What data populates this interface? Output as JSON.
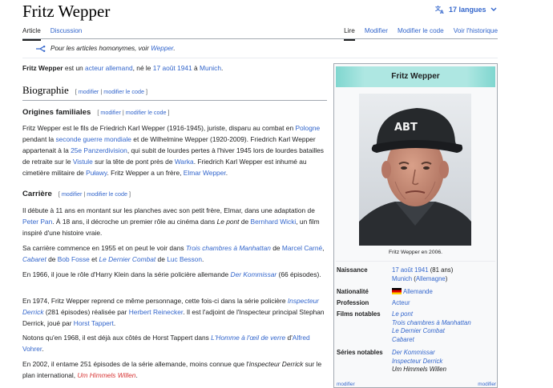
{
  "page": {
    "title": "Fritz Wepper",
    "languages": "17 langues"
  },
  "tabs": {
    "article": "Article",
    "discussion": "Discussion",
    "read": "Lire",
    "edit": "Modifier",
    "edit_code": "Modifier le code",
    "history": "Voir l'historique"
  },
  "hatnote": {
    "text": "Pour les articles homonymes, voir ",
    "link": "Wepper",
    "end": "."
  },
  "lead": [
    {
      "t": "Fritz Wepper",
      "k": "b"
    },
    {
      "t": " est un ",
      "k": "t"
    },
    {
      "t": "acteur allemand",
      "k": "a"
    },
    {
      "t": ", né le ",
      "k": "t"
    },
    {
      "t": "17 août 1941",
      "k": "a"
    },
    {
      "t": " à ",
      "k": "t"
    },
    {
      "t": "Munich",
      "k": "a"
    },
    {
      "t": ".",
      "k": "t"
    }
  ],
  "edit_links": {
    "open": "[ ",
    "modifier": "modifier",
    "sep": " | ",
    "modifier_code": "modifier le code",
    "close": " ]"
  },
  "sections": {
    "biographie": "Biographie",
    "origines": "Origines familiales",
    "carriere": "Carrière"
  },
  "p_origines": [
    {
      "t": "Fritz Wepper est le fils de Friedrich Karl Wepper (1916-1945), juriste, disparu au combat en ",
      "k": "t"
    },
    {
      "t": "Pologne",
      "k": "a"
    },
    {
      "t": " pendant la ",
      "k": "t"
    },
    {
      "t": "seconde guerre mondiale",
      "k": "a"
    },
    {
      "t": " et de Wilhelmine Wepper (1920-2009). Friedrich Karl Wepper appartenait à la ",
      "k": "t"
    },
    {
      "t": "25e Panzerdivision",
      "k": "a"
    },
    {
      "t": ", qui subit de lourdes pertes à l'hiver 1945 lors de lourdes batailles de retraite sur le ",
      "k": "t"
    },
    {
      "t": "Vistule",
      "k": "a"
    },
    {
      "t": " sur la tête de pont près de ",
      "k": "t"
    },
    {
      "t": "Warka",
      "k": "a"
    },
    {
      "t": ". Friedrich Karl Wepper est inhumé au cimetière militaire de ",
      "k": "t"
    },
    {
      "t": "Puławy",
      "k": "a"
    },
    {
      "t": ". Fritz Wepper a un frère, ",
      "k": "t"
    },
    {
      "t": "Elmar Wepper",
      "k": "a"
    },
    {
      "t": ".",
      "k": "t"
    }
  ],
  "p_carriere_1": [
    {
      "t": "Il débute à 11 ans en montant sur les planches avec son petit frère, Elmar, dans une adaptation de ",
      "k": "t"
    },
    {
      "t": "Peter Pan",
      "k": "a"
    },
    {
      "t": ". À 18 ans, il décroche un premier rôle au cinéma dans ",
      "k": "t"
    },
    {
      "t": "Le pont",
      "k": "i"
    },
    {
      "t": " de ",
      "k": "t"
    },
    {
      "t": "Bernhard Wicki",
      "k": "a"
    },
    {
      "t": ", un film inspiré d'une histoire vraie.",
      "k": "t"
    }
  ],
  "p_carriere_2": [
    {
      "t": "Sa carrière commence en 1955 et on peut le voir dans ",
      "k": "t"
    },
    {
      "t": "Trois chambres à Manhattan",
      "k": "ai"
    },
    {
      "t": " de ",
      "k": "t"
    },
    {
      "t": "Marcel Carné",
      "k": "a"
    },
    {
      "t": ", ",
      "k": "t"
    },
    {
      "t": "Cabaret",
      "k": "ai"
    },
    {
      "t": " de ",
      "k": "t"
    },
    {
      "t": "Bob Fosse",
      "k": "a"
    },
    {
      "t": " et ",
      "k": "t"
    },
    {
      "t": "Le Dernier Combat",
      "k": "ai"
    },
    {
      "t": " de ",
      "k": "t"
    },
    {
      "t": "Luc Besson",
      "k": "a"
    },
    {
      "t": ".",
      "k": "t"
    }
  ],
  "p_carriere_3": [
    {
      "t": "En 1966, il joue le rôle d'Harry Klein dans la série policière allemande ",
      "k": "t"
    },
    {
      "t": "Der Kommissar",
      "k": "ai"
    },
    {
      "t": " (66 épisodes).",
      "k": "t"
    }
  ],
  "p_carriere_4": [
    {
      "t": "En 1974, Fritz Wepper reprend ce même personnage, cette fois-ci dans la série policière ",
      "k": "t"
    },
    {
      "t": "Inspecteur Derrick",
      "k": "ai"
    },
    {
      "t": " (281 épisodes) réalisée par ",
      "k": "t"
    },
    {
      "t": "Herbert Reinecker",
      "k": "a"
    },
    {
      "t": ". Il est l'adjoint de l'Inspecteur principal Stephan Derrick, joué par ",
      "k": "t"
    },
    {
      "t": "Horst Tappert",
      "k": "a"
    },
    {
      "t": ".",
      "k": "t"
    }
  ],
  "p_carriere_5": [
    {
      "t": "Notons qu'en 1968, il est déjà aux côtés de Horst Tappert dans ",
      "k": "t"
    },
    {
      "t": "L'Homme à l'œil de verre",
      "k": "ai"
    },
    {
      "t": " d'",
      "k": "t"
    },
    {
      "t": "Alfred Vohrer",
      "k": "a"
    },
    {
      "t": ".",
      "k": "t"
    }
  ],
  "p_carriere_6": [
    {
      "t": "En 2002, il entame 251 épisodes de la série allemande, moins connue que l'",
      "k": "t"
    },
    {
      "t": "inspecteur Derrick",
      "k": "i"
    },
    {
      "t": " sur le plan international, ",
      "k": "t"
    },
    {
      "t": "Um Himmels Willen",
      "k": "ri"
    },
    {
      "t": ".",
      "k": "t"
    }
  ],
  "infobox": {
    "title": "Fritz Wepper",
    "caption": "Fritz Wepper en 2006.",
    "cap_text": "ABT",
    "rows": {
      "naissance_label": "Naissance",
      "naissance_date": "17 août 1941",
      "naissance_age": " (81 ans)",
      "naissance_city": "Munich",
      "naissance_country_open": " (",
      "naissance_country": "Allemagne",
      "naissance_country_close": ")",
      "nationalite_label": "Nationalité",
      "nationalite": "Allemande",
      "profession_label": "Profession",
      "profession": "Acteur",
      "films_label": "Films notables",
      "films": [
        "Le pont",
        "Trois chambres à Manhattan",
        "Le Dernier Combat",
        "Cabaret"
      ],
      "series_label": "Séries notables",
      "series": [
        "Der Kommissar",
        "Inspecteur Derrick",
        "Um Himmels Willen"
      ]
    },
    "footer_left": "modifier",
    "footer_right": "modifier"
  },
  "colors": {
    "link": "#3366cc",
    "redlink": "#d73333",
    "infobox_header": "#aee7e2"
  }
}
